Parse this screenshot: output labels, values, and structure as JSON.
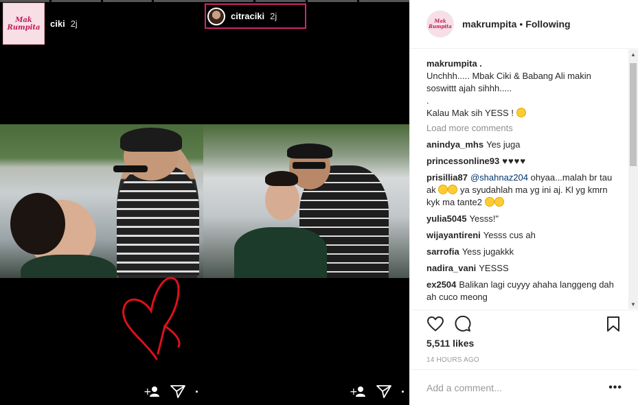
{
  "post": {
    "left_story": {
      "username": "ciki",
      "time": "2j",
      "logo_text": "Mak Rumpita"
    },
    "right_story": {
      "username": "citraciki",
      "time": "2j"
    }
  },
  "sidebar": {
    "account": "makrumpita",
    "separator": "•",
    "follow_status": "Following",
    "logo_text": "Mak Rumpita"
  },
  "caption": {
    "username": "makrumpita .",
    "line1": "Unchhh..... Mbak Ciki & Babang Ali makin",
    "line2": "soswittt ajah sihhh.....",
    "line3": ".",
    "line4": "Kalau Mak sih YESS !"
  },
  "load_more": "Load more comments",
  "comments": [
    {
      "user": "anindya_mhs",
      "text": "Yes juga"
    },
    {
      "user": "princessonline93",
      "text": "♥♥♥♥"
    },
    {
      "user": "prisillia87",
      "mention": "@shahnaz204",
      "text": "ohyaa...malah br tau ak",
      "text2": "ya syudahlah ma yg ini aj. Kl yg kmrn kyk ma tante2"
    },
    {
      "user": "yulia5045",
      "text": "Yesss!\""
    },
    {
      "user": "wijayantireni",
      "text": "Yesss cus ah"
    },
    {
      "user": "sarrofia",
      "text": "Yess jugakkk"
    },
    {
      "user": "nadira_vani",
      "text": "YESSS"
    },
    {
      "user": "ex2504",
      "text": "Balikan lagi cuyyy ahaha langgeng dah ah cuco meong"
    }
  ],
  "likes": "5,511 likes",
  "timestamp": "14 HOURS AGO",
  "add_comment_placeholder": "Add a comment...",
  "more_label": "•••",
  "icons": {
    "like": "heart-icon",
    "comment": "comment-icon",
    "save": "bookmark-icon",
    "add_friend": "add-person-icon",
    "share": "send-icon"
  },
  "colors": {
    "highlight_border": "#d4266f",
    "mention": "#003569",
    "heart_drawing": "#e0101a"
  }
}
